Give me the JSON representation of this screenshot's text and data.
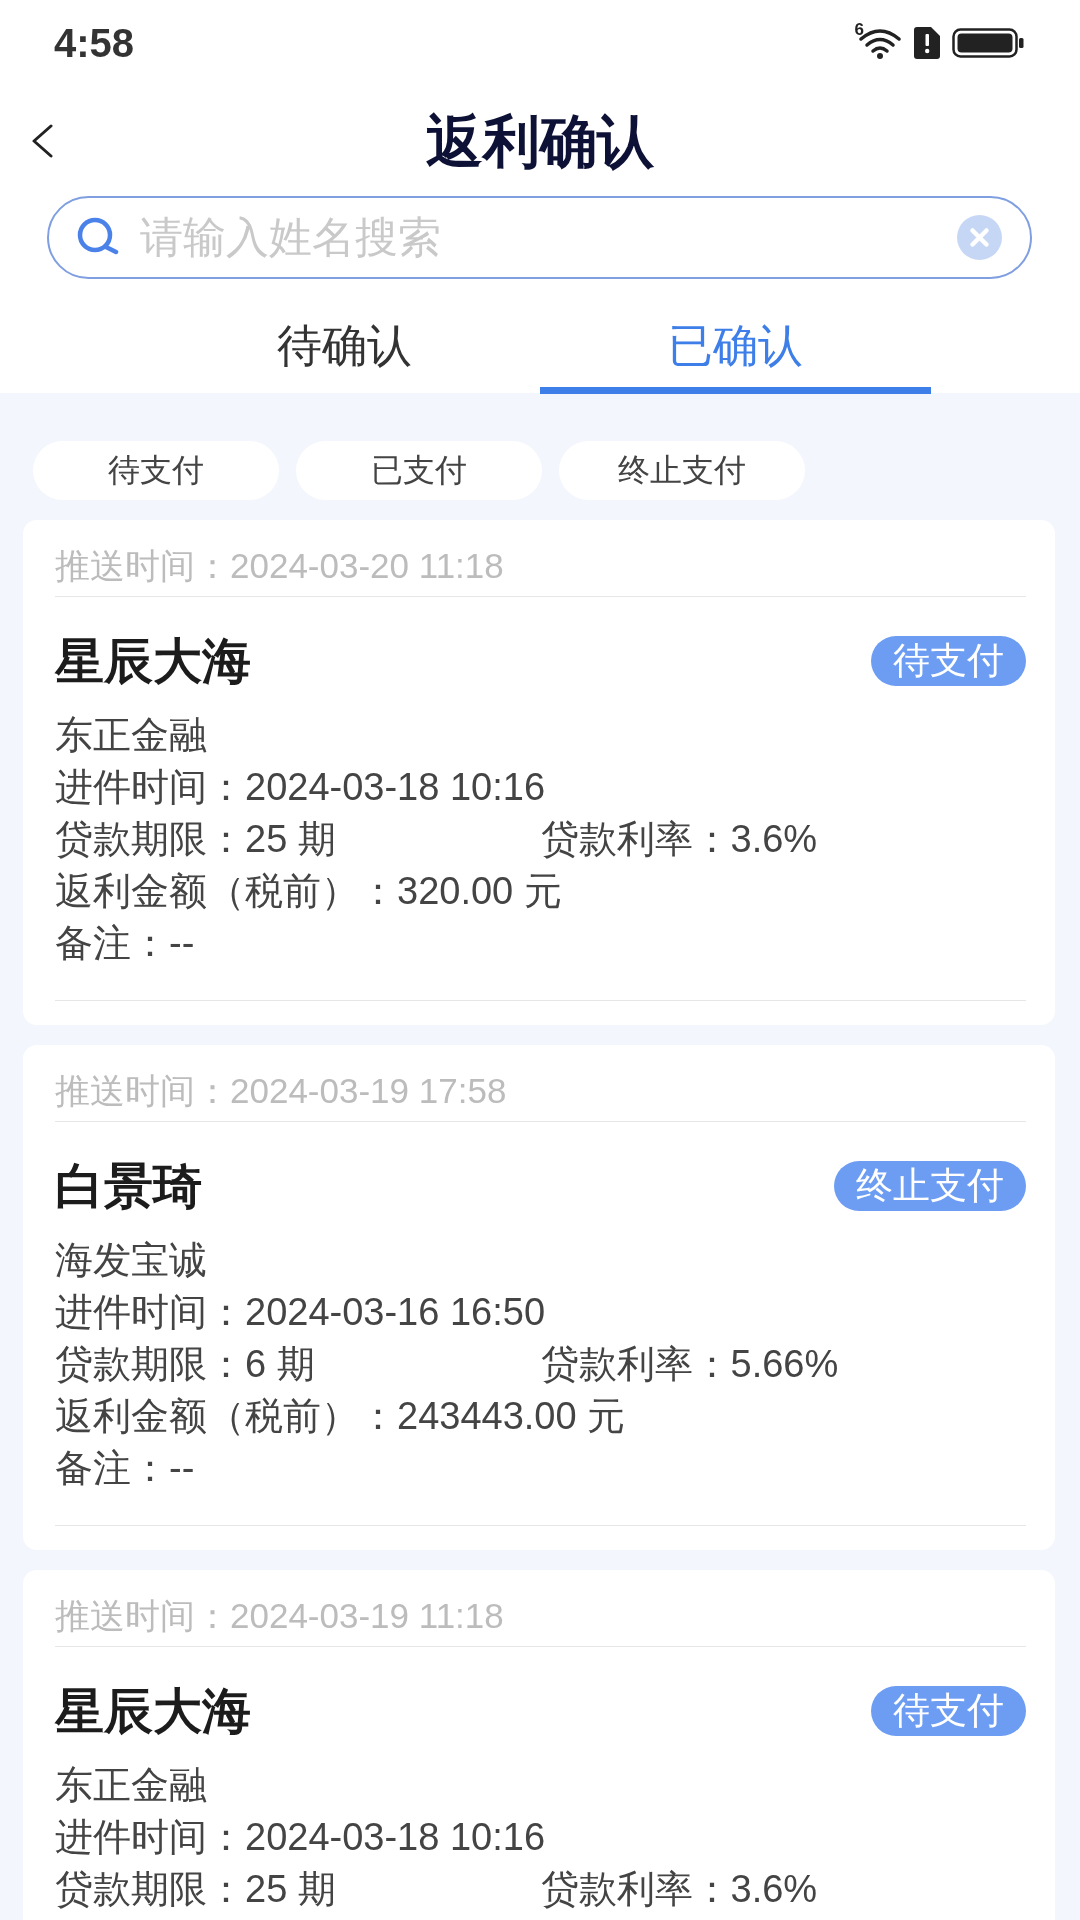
{
  "status_bar": {
    "time": "4:58",
    "wifi_label": "6"
  },
  "header": {
    "title": "返利确认"
  },
  "search": {
    "placeholder": "请输入姓名搜索"
  },
  "tabs": [
    {
      "label": "待确认",
      "selected": false
    },
    {
      "label": "已确认",
      "selected": true
    }
  ],
  "filters": [
    {
      "label": "待支付",
      "selected": false
    },
    {
      "label": "已支付",
      "selected": false
    },
    {
      "label": "终止支付",
      "selected": false
    }
  ],
  "records": [
    {
      "push_time": {
        "label": "推送时间：",
        "value": "2024-03-20 11:18"
      },
      "name": "星辰大海",
      "status": "待支付",
      "institution": "东正金融",
      "rows": [
        {
          "items": [
            {
              "label": "进件时间：",
              "value": "2024-03-18 10:16"
            }
          ]
        },
        {
          "items": [
            {
              "label": "贷款期限：",
              "value": "25 期"
            },
            {
              "label": "贷款利率：",
              "value": "3.6%"
            }
          ]
        },
        {
          "items": [
            {
              "label": "返利金额（税前）：",
              "value": "320.00 元"
            }
          ]
        },
        {
          "items": [
            {
              "label": "备注：",
              "value": "--"
            }
          ]
        }
      ]
    },
    {
      "push_time": {
        "label": "推送时间：",
        "value": "2024-03-19 17:58"
      },
      "name": "白景琦",
      "status": "终止支付",
      "institution": "海发宝诚",
      "rows": [
        {
          "items": [
            {
              "label": "进件时间：",
              "value": "2024-03-16 16:50"
            }
          ]
        },
        {
          "items": [
            {
              "label": "贷款期限：",
              "value": "6 期"
            },
            {
              "label": "贷款利率：",
              "value": "5.66%"
            }
          ]
        },
        {
          "items": [
            {
              "label": "返利金额（税前）：",
              "value": "243443.00 元"
            }
          ]
        },
        {
          "items": [
            {
              "label": "备注：",
              "value": "--"
            }
          ]
        }
      ]
    },
    {
      "push_time": {
        "label": "推送时间：",
        "value": "2024-03-19 11:18"
      },
      "name": "星辰大海",
      "status": "待支付",
      "institution": "东正金融",
      "rows": [
        {
          "items": [
            {
              "label": "进件时间：",
              "value": "2024-03-18 10:16"
            }
          ]
        },
        {
          "items": [
            {
              "label": "贷款期限：",
              "value": "25 期"
            },
            {
              "label": "贷款利率：",
              "value": "3.6%"
            }
          ]
        }
      ]
    }
  ]
}
